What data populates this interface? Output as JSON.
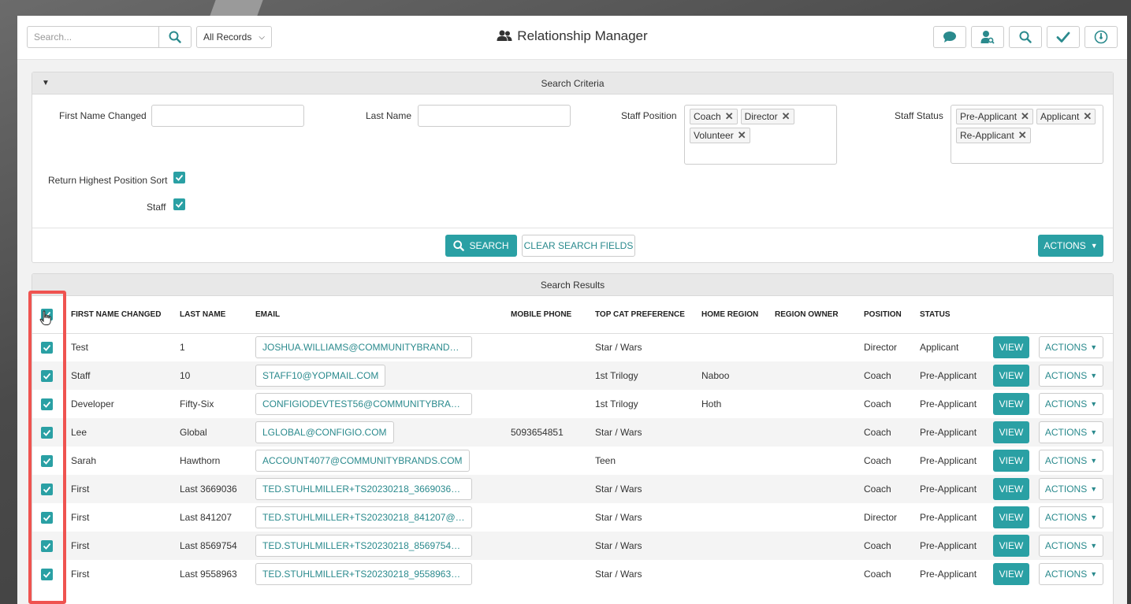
{
  "topbar": {
    "search_placeholder": "Search...",
    "records_filter": "All Records",
    "title": "Relationship Manager",
    "icons": [
      "chat-icon",
      "user-search-icon",
      "search-icon",
      "check-icon",
      "dashboard-icon"
    ]
  },
  "criteria": {
    "header": "Search Criteria",
    "first_name_label": "First Name Changed",
    "first_name_value": "",
    "last_name_label": "Last Name",
    "last_name_value": "",
    "staff_position_label": "Staff Position",
    "staff_position_tags": [
      "Coach",
      "Director",
      "Volunteer"
    ],
    "staff_status_label": "Staff Status",
    "staff_status_tags": [
      "Pre-Applicant",
      "Applicant",
      "Re-Applicant"
    ],
    "highest_position_label": "Return Highest Position Sort",
    "highest_position_checked": true,
    "staff_label": "Staff",
    "staff_checked": true,
    "search_button": "SEARCH",
    "clear_button": "CLEAR SEARCH FIELDS",
    "actions_button": "ACTIONS"
  },
  "results": {
    "header": "Search Results",
    "columns": [
      "FIRST NAME CHANGED",
      "LAST NAME",
      "EMAIL",
      "MOBILE PHONE",
      "TOP CAT PREFERENCE",
      "HOME REGION",
      "REGION OWNER",
      "POSITION",
      "STATUS"
    ],
    "view_label": "VIEW",
    "actions_label": "ACTIONS",
    "rows": [
      {
        "first": "Test",
        "last": "1",
        "email": "JOSHUA.WILLIAMS@COMMUNITYBRANDS.C...",
        "phone": "",
        "cat": "Star / Wars",
        "region": "",
        "owner": "",
        "position": "Director",
        "status": "Applicant"
      },
      {
        "first": "Staff",
        "last": "10",
        "email": "STAFF10@YOPMAIL.COM",
        "phone": "",
        "cat": "1st Trilogy",
        "region": "Naboo",
        "owner": "",
        "position": "Coach",
        "status": "Pre-Applicant"
      },
      {
        "first": "Developer",
        "last": "Fifty-Six",
        "email": "CONFIGIODEVTEST56@COMMUNITYBRANDS...",
        "phone": "",
        "cat": "1st Trilogy",
        "region": "Hoth",
        "owner": "",
        "position": "Coach",
        "status": "Pre-Applicant"
      },
      {
        "first": "Lee",
        "last": "Global",
        "email": "LGLOBAL@CONFIGIO.COM",
        "phone": "5093654851",
        "cat": "Star / Wars",
        "region": "",
        "owner": "",
        "position": "Coach",
        "status": "Pre-Applicant"
      },
      {
        "first": "Sarah",
        "last": "Hawthorn",
        "email": "ACCOUNT4077@COMMUNITYBRANDS.COM",
        "phone": "",
        "cat": "Teen",
        "region": "",
        "owner": "",
        "position": "Coach",
        "status": "Pre-Applicant"
      },
      {
        "first": "First",
        "last": "Last 3669036",
        "email": "TED.STUHLMILLER+TS20230218_3669036@C...",
        "phone": "",
        "cat": "Star / Wars",
        "region": "",
        "owner": "",
        "position": "Coach",
        "status": "Pre-Applicant"
      },
      {
        "first": "First",
        "last": "Last 841207",
        "email": "TED.STUHLMILLER+TS20230218_841207@C...",
        "phone": "",
        "cat": "Star / Wars",
        "region": "",
        "owner": "",
        "position": "Director",
        "status": "Pre-Applicant"
      },
      {
        "first": "First",
        "last": "Last 8569754",
        "email": "TED.STUHLMILLER+TS20230218_8569754@C...",
        "phone": "",
        "cat": "Star / Wars",
        "region": "",
        "owner": "",
        "position": "Coach",
        "status": "Pre-Applicant"
      },
      {
        "first": "First",
        "last": "Last 9558963",
        "email": "TED.STUHLMILLER+TS20230218_9558963@C...",
        "phone": "",
        "cat": "Star / Wars",
        "region": "",
        "owner": "",
        "position": "Coach",
        "status": "Pre-Applicant"
      }
    ]
  },
  "colors": {
    "accent": "#2aa0a4",
    "accent_text": "#2a8a8d",
    "highlight": "#ef5350"
  }
}
